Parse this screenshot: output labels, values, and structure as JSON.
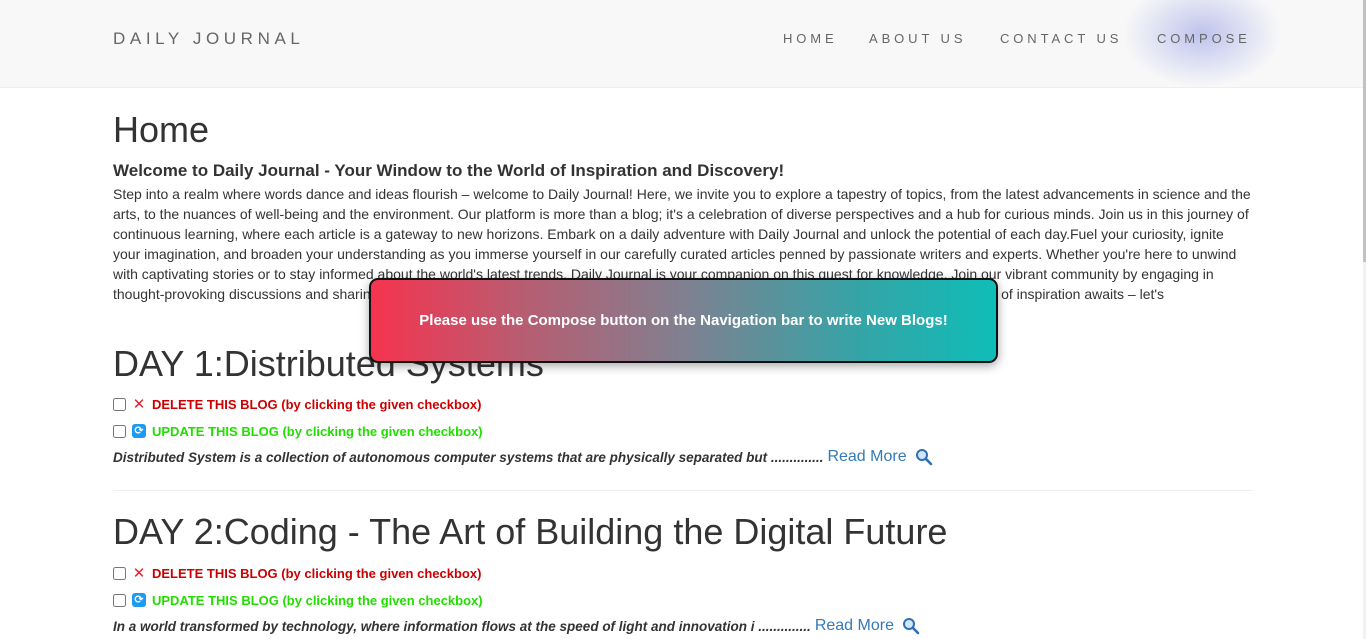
{
  "nav": {
    "brand": "DAILY JOURNAL",
    "links": [
      "HOME",
      "ABOUT US",
      "CONTACT US",
      "COMPOSE"
    ]
  },
  "page": {
    "title": "Home",
    "welcome_heading": "Welcome to Daily Journal - Your Window to the World of Inspiration and Discovery!",
    "intro": "Step into a realm where words dance and ideas flourish – welcome to Daily Journal! Here, we invite you to explore a tapestry of topics, from the latest advancements in science and the arts, to the nuances of well-being and the environment. Our platform is more than a blog; it's a celebration of diverse perspectives and a hub for curious minds. Join us in this journey of continuous learning, where each article is a gateway to new horizons. Embark on a daily adventure with Daily Journal and unlock the potential of each day.Fuel your curiosity, ignite your imagination, and broaden your understanding as you immerse yourself in our carefully curated articles penned by passionate writers and experts. Whether you're here to unwind with captivating stories or to stay informed about the world's latest trends, Daily Journal is your companion on this quest for knowledge. Join our vibrant community by engaging in thought-provoking discussions and sharing your insights. Together, let's embark on a journey where learning knows no bounds. Your daily dose of inspiration awaits – let's"
  },
  "posts": [
    {
      "title": "DAY 1:Distributed Systems",
      "delete_label": "DELETE THIS BLOG (by clicking the given checkbox)",
      "update_label": "UPDATE THIS BLOG (by clicking the given checkbox)",
      "excerpt": "Distributed System is a collection of autonomous computer systems that are physically separated but ..............",
      "read_more": "Read More"
    },
    {
      "title": "DAY 2:Coding - The Art of Building the Digital Future",
      "delete_label": "DELETE THIS BLOG (by clicking the given checkbox)",
      "update_label": "UPDATE THIS BLOG (by clicking the given checkbox)",
      "excerpt": "In a world transformed by technology, where information flows at the speed of light and innovation i ..............",
      "read_more": "Read More"
    }
  ],
  "toast": {
    "message": "Please use the Compose button on the Navigation bar to write New Blogs!"
  },
  "icons": {
    "delete": "cross-mark-icon",
    "update": "cycle-arrows-icon",
    "read_more": "magnifier-icon"
  },
  "colors": {
    "delete_text": "#cc0000",
    "update_text": "#22dd00",
    "link": "#337ab7",
    "toast_left": "#f6334f",
    "toast_right": "#0fbdb7"
  }
}
